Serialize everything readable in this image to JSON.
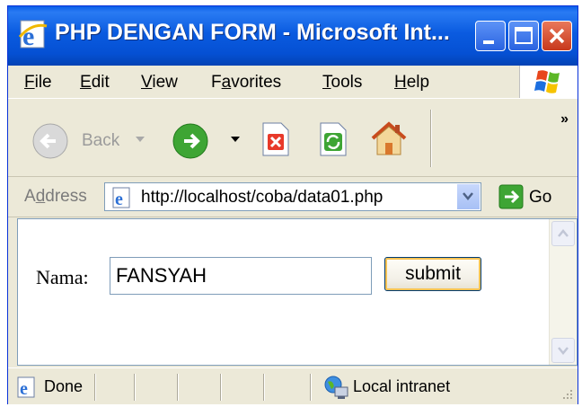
{
  "window": {
    "title": "PHP DENGAN FORM - Microsoft Int..."
  },
  "menu": {
    "items": [
      {
        "label": "File",
        "key": "F",
        "rest": "ile"
      },
      {
        "label": "Edit",
        "key": "E",
        "rest": "dit"
      },
      {
        "label": "View",
        "key": "V",
        "rest": "iew"
      },
      {
        "label": "Favorites",
        "pre": "F",
        "key": "a",
        "rest": "vorites"
      },
      {
        "label": "Tools",
        "key": "T",
        "rest": "ools"
      },
      {
        "label": "Help",
        "key": "H",
        "rest": "elp"
      }
    ]
  },
  "toolbar": {
    "back_label": "Back",
    "more": "»"
  },
  "address": {
    "label_pre": "A",
    "label_key": "d",
    "label_rest": "dress",
    "url": "http://localhost/coba/data01.php",
    "go_label": "Go"
  },
  "form": {
    "label": "Nama:",
    "value": "FANSYAH",
    "submit_label": "submit"
  },
  "status": {
    "text": "Done",
    "zone": "Local intranet"
  }
}
